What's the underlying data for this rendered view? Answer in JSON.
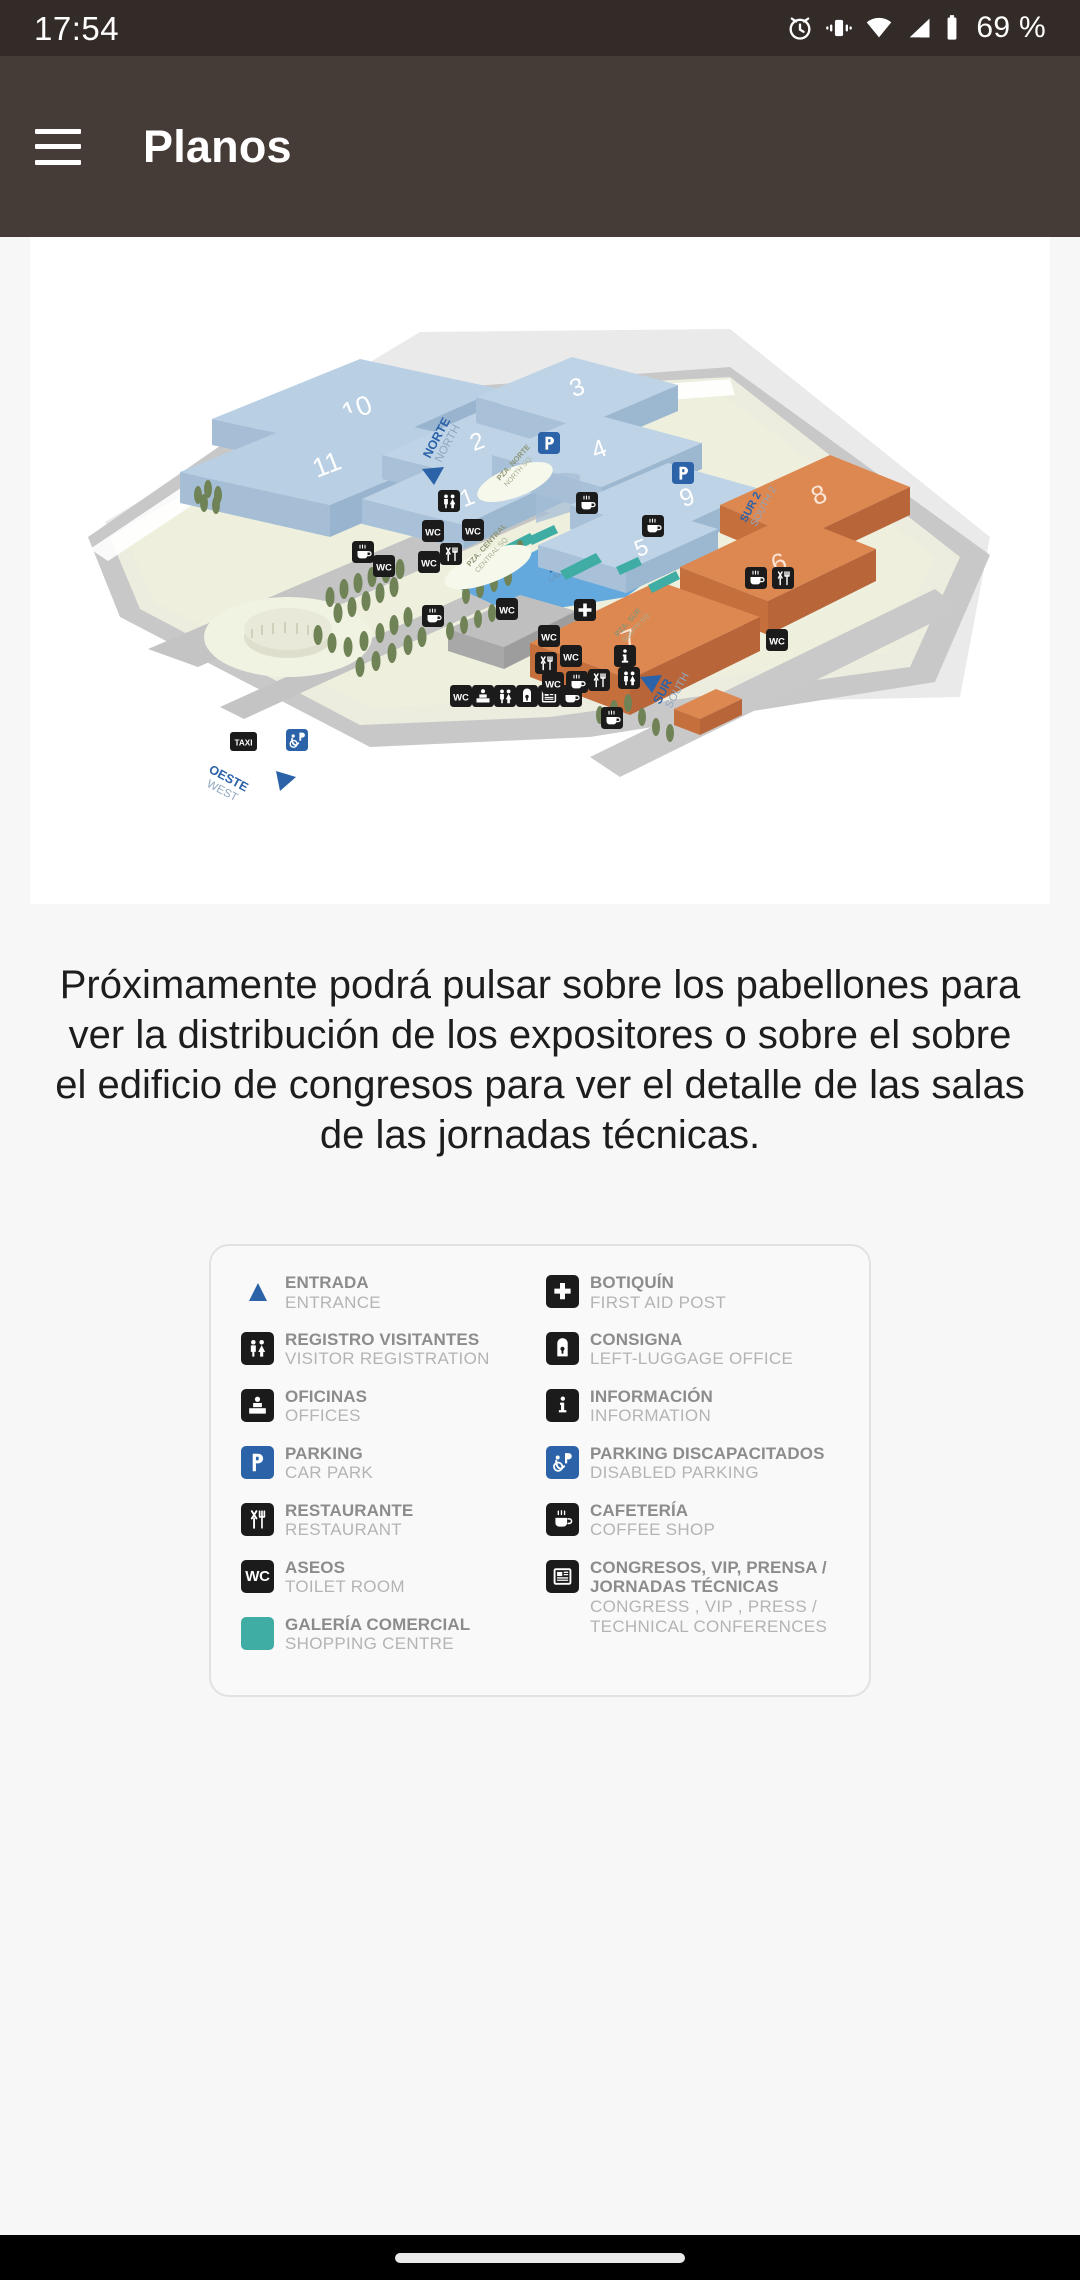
{
  "status_bar": {
    "time": "17:54",
    "battery": "69 %",
    "icons": [
      "alarm-icon",
      "vibrate-icon",
      "wifi-icon",
      "signal-icon",
      "battery-icon"
    ],
    "background": "#332b28"
  },
  "app_bar": {
    "title": "Planos",
    "menu_icon": "hamburger-icon",
    "background": "#453b37"
  },
  "map": {
    "alt": "Plano isométrico del recinto ferial",
    "pavilions_blue": [
      "10",
      "11",
      "2",
      "1",
      "3",
      "4",
      "9",
      "5"
    ],
    "pavilions_orange": [
      "8",
      "6",
      "7"
    ],
    "direction_labels": [
      {
        "es": "NORTE",
        "en": "NORTH"
      },
      {
        "es": "OESTE",
        "en": "WEST"
      },
      {
        "es": "SUR",
        "en": "SOUTH"
      },
      {
        "es": "SUR 2",
        "en": "SOUTH 2"
      }
    ],
    "place_labels": [
      {
        "es": "PZA. NORTE",
        "en": "NORTH SQ."
      },
      {
        "es": "PZA. CENTRAL",
        "en": "CENTRAL SQ."
      },
      {
        "es": "PZA. SUR",
        "en": "SOUTH SQ."
      },
      {
        "es": "LAGO",
        "en": "LAKE"
      },
      {
        "es": "TAXI",
        "en": ""
      }
    ],
    "colors": {
      "pavilion_blue_top": "#b9cfe3",
      "pavilion_blue_side": "#a5bed6",
      "pavilion_orange_top": "#dd8751",
      "pavilion_orange_side": "#c56f3d",
      "ground": "#eef0dd",
      "asphalt": "#c6c6c6",
      "lake": "#63a9dd",
      "teal": "#3fada3",
      "marker": "#1b1b1b",
      "blue_sign": "#2b62a8"
    }
  },
  "blurb": {
    "text": "Próximamente podrá pulsar sobre los pabellones para ver la distribución de los expositores o sobre el sobre el edificio de congresos para ver el detalle de las salas de las jornadas técnicas."
  },
  "legend": {
    "left_column": [
      {
        "icon": "entrance-triangle-icon",
        "icon_style": "plain-blue-triangle",
        "es": "ENTRADA",
        "en": "ENTRANCE"
      },
      {
        "icon": "visitor-registration-icon",
        "icon_style": "dark",
        "es": "REGISTRO VISITANTES",
        "en": "VISITOR REGISTRATION"
      },
      {
        "icon": "offices-icon",
        "icon_style": "dark",
        "es": "OFICINAS",
        "en": "OFFICES"
      },
      {
        "icon": "parking-icon",
        "icon_style": "blue",
        "es": "PARKING",
        "en": "CAR PARK"
      },
      {
        "icon": "restaurant-icon",
        "icon_style": "dark",
        "es": "RESTAURANTE",
        "en": "RESTAURANT"
      },
      {
        "icon": "toilet-wc-icon",
        "icon_style": "dark",
        "es": "ASEOS",
        "en": "TOILET ROOM"
      },
      {
        "icon": "shopping-centre-swatch-icon",
        "icon_style": "teal",
        "es": "GALERÍA COMERCIAL",
        "en": "SHOPPING CENTRE"
      }
    ],
    "right_column": [
      {
        "icon": "first-aid-icon",
        "icon_style": "dark",
        "es": "BOTIQUÍN",
        "en": "FIRST AID POST"
      },
      {
        "icon": "left-luggage-icon",
        "icon_style": "dark",
        "es": "CONSIGNA",
        "en": "LEFT-LUGGAGE OFFICE"
      },
      {
        "icon": "information-icon",
        "icon_style": "dark",
        "es": "INFORMACIÓN",
        "en": "INFORMATION"
      },
      {
        "icon": "disabled-parking-icon",
        "icon_style": "blue",
        "es": "PARKING DISCAPACITADOS",
        "en": "DISABLED PARKING"
      },
      {
        "icon": "coffee-shop-icon",
        "icon_style": "dark",
        "es": "CAFETERÍA",
        "en": "COFFEE SHOP"
      },
      {
        "icon": "congress-icon",
        "icon_style": "dark",
        "es": "CONGRESOS, VIP, PRENSA / JORNADAS TÉCNICAS",
        "en": "CONGRESS , VIP , PRESS / TECHNICAL CONFERENCES"
      }
    ]
  },
  "nav_bar": {
    "gesture_pill": "home-gesture-pill"
  }
}
